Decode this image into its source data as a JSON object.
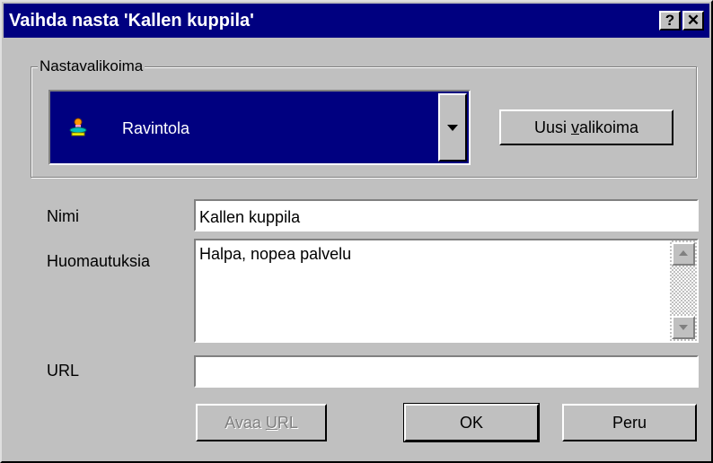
{
  "window": {
    "title": "Vaihda nasta 'Kallen kuppila'",
    "help_label": "?",
    "close_label": "✕"
  },
  "pinset": {
    "group_label": "Nastavalikoima",
    "selected": "Ravintola",
    "icon": "restaurant-pin-icon",
    "new_set_label": "Uusi valikoima",
    "new_set_mnemonic": "v"
  },
  "form": {
    "name_label": "Nimi",
    "name_value": "Kallen kuppila",
    "notes_label": "Huomautuksia",
    "notes_value": "Halpa, nopea palvelu",
    "url_label": "URL",
    "url_value": ""
  },
  "buttons": {
    "open_url_label": "Avaa URL",
    "ok_label": "OK",
    "cancel_label": "Peru"
  },
  "colors": {
    "titlebar": "#000080",
    "face": "#c0c0c0",
    "selection": "#000080"
  }
}
